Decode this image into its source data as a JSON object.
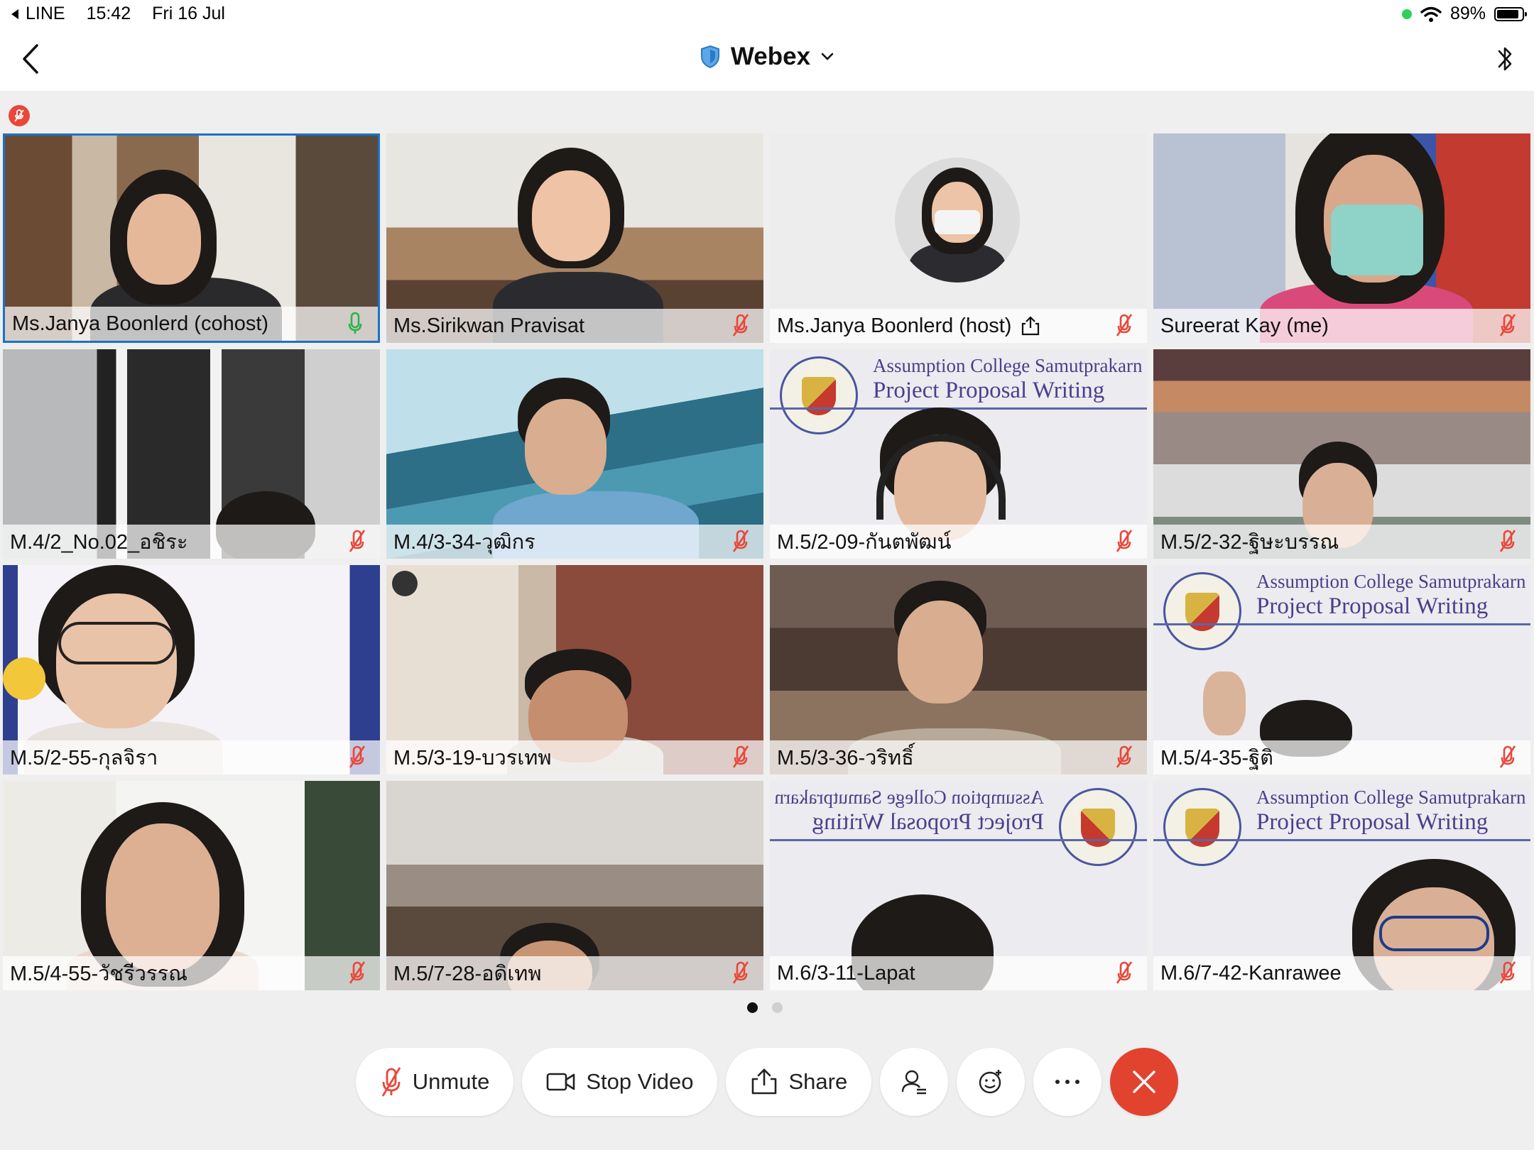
{
  "status_bar": {
    "back_app": "LINE",
    "time": "15:42",
    "date": "Fri 16 Jul",
    "battery": "89%",
    "battery_level": 0.89
  },
  "header": {
    "title": "Webex"
  },
  "participants": [
    {
      "name": "Ms.Janya Boonlerd (cohost)",
      "mic": "on",
      "active": true
    },
    {
      "name": "Ms.Sirikwan Pravisat",
      "mic": "muted"
    },
    {
      "name": "Ms.Janya Boonlerd (host)",
      "mic": "muted",
      "sharing": true
    },
    {
      "name": "Sureerat Kay (me)",
      "mic": "muted"
    },
    {
      "name": "M.4/2_No.02_อชิระ",
      "mic": "muted"
    },
    {
      "name": "M.4/3-34-วุฒิกร",
      "mic": "muted"
    },
    {
      "name": "M.5/2-09-กันตพัฒน์",
      "mic": "muted"
    },
    {
      "name": "M.5/2-32-ฐิษะบรรณ",
      "mic": "muted"
    },
    {
      "name": "M.5/2-55-กุลจิรา",
      "mic": "muted"
    },
    {
      "name": "M.5/3-19-บวรเทพ",
      "mic": "muted"
    },
    {
      "name": "M.5/3-36-วริทธิ์",
      "mic": "muted"
    },
    {
      "name": "M.5/4-35-ฐิติ",
      "mic": "muted"
    },
    {
      "name": "M.5/4-55-วัชรีวรรณ",
      "mic": "muted"
    },
    {
      "name": "M.5/7-28-อดิเทพ",
      "mic": "muted"
    },
    {
      "name": "M.6/3-11-Lapat",
      "mic": "muted"
    },
    {
      "name": "M.6/7-42-Kanrawee",
      "mic": "muted"
    }
  ],
  "banner": {
    "line1": "Assumption College Samutprakarn",
    "line2": "Project Proposal Writing"
  },
  "pagination": {
    "pages": 2,
    "current": 1
  },
  "controls": {
    "unmute_label": "Unmute",
    "stop_video_label": "Stop Video",
    "share_label": "Share"
  },
  "colors": {
    "end_call": "#e2432f",
    "active_border": "#1a73c8",
    "mic_muted": "#e9473a",
    "mic_on": "#2fb34a"
  }
}
